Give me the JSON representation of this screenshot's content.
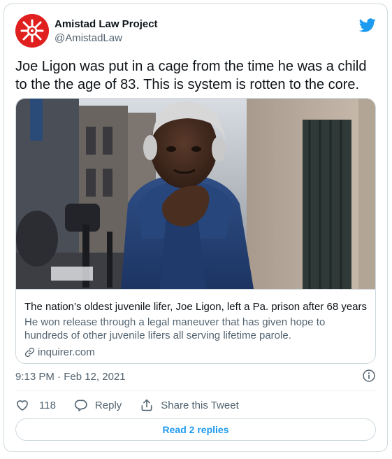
{
  "author": {
    "name": "Amistad Law Project",
    "handle": "@AmistadLaw"
  },
  "tweet": {
    "text": "Joe Ligon was put in a cage from the time he was a child to the the age of 83. This is system is rotten to the core.",
    "timestamp": "9:13 PM · Feb 12, 2021"
  },
  "card": {
    "title": "The nation’s oldest juvenile lifer, Joe Ligon, left a Pa. prison after 68 years",
    "description": "He won release through a legal maneuver that has given hope to hundreds of other juvenile lifers all serving lifetime parole.",
    "domain": "inquirer.com"
  },
  "actions": {
    "like_count": "118",
    "reply_label": "Reply",
    "share_label": "Share this Tweet"
  },
  "read_replies_label": "Read 2 replies",
  "icons": [
    "avatar-logo-icon",
    "twitter-bird-icon",
    "link-icon",
    "info-icon",
    "heart-icon",
    "reply-icon",
    "share-icon"
  ],
  "colors": {
    "accent": "#1d9bf0",
    "avatar_bg": "#e0201f",
    "text_primary": "#0f1419",
    "text_secondary": "#536471",
    "border": "#cfd9de"
  }
}
